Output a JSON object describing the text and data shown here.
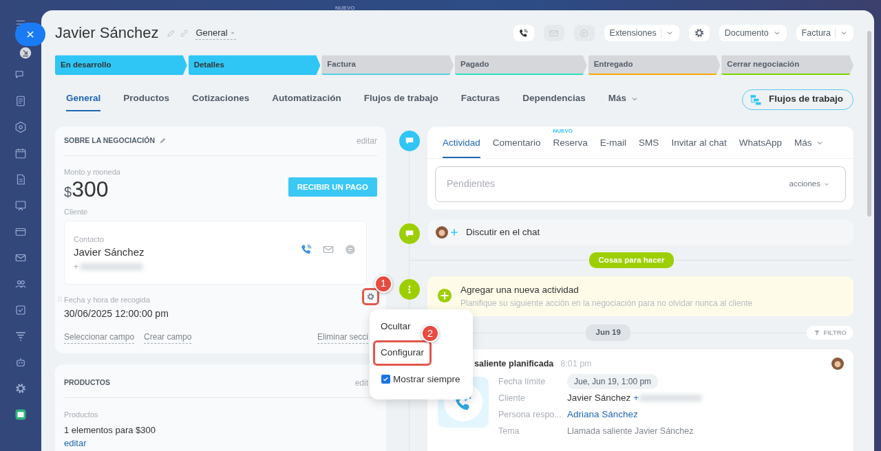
{
  "background": {
    "label": "NUEVO"
  },
  "header": {
    "title": "Javier Sánchez",
    "view": "General",
    "toolbar": [
      {
        "kind": "phone",
        "disabled": false
      },
      {
        "kind": "mail",
        "disabled": true
      },
      {
        "kind": "chat",
        "disabled": true
      },
      {
        "kind": "split",
        "label": "Extensiones",
        "disabled": false
      },
      {
        "kind": "settings",
        "disabled": false
      },
      {
        "kind": "dropdown",
        "label": "Documento",
        "disabled": false
      },
      {
        "kind": "split",
        "label": "Factura",
        "disabled": false
      }
    ]
  },
  "stages": [
    {
      "label": "En desarrollo",
      "color": "#2fc6f6",
      "reached": true
    },
    {
      "label": "Detalles",
      "color": "#2fc6f6",
      "reached": true
    },
    {
      "label": "Factura",
      "color": "#55d0e0",
      "reached": false
    },
    {
      "label": "Pagado",
      "color": "#2fe0c0",
      "reached": false
    },
    {
      "label": "Entregado",
      "color": "#ffa900",
      "reached": false
    },
    {
      "label": "Cerrar negociación",
      "color": "#7bd500",
      "reached": false
    }
  ],
  "tabs": [
    {
      "label": "General",
      "selected": true
    },
    {
      "label": "Productos",
      "selected": false
    },
    {
      "label": "Cotizaciones",
      "selected": false
    },
    {
      "label": "Automatización",
      "selected": false
    },
    {
      "label": "Flujos de trabajo",
      "selected": false
    },
    {
      "label": "Facturas",
      "selected": false
    },
    {
      "label": "Dependencias",
      "selected": false
    }
  ],
  "tabs_more": "Más",
  "workflow_button": "Flujos de trabajo",
  "about": {
    "title": "SOBRE LA NEGOCIACIÓN",
    "edit": "editar",
    "amount_label": "Monto y moneda",
    "currency": "$",
    "amount": "300",
    "pay_button": "RECIBIR UN PAGO",
    "client_label": "Cliente",
    "contact": {
      "label": "Contacto",
      "name": "Javier Sánchez",
      "phone_prefix": "+"
    },
    "field": {
      "label": "Fecha y hora de recogida",
      "value": "30/06/2025 12:00:00 pm",
      "highlighted": true,
      "callout": "1"
    },
    "links": [
      "Seleccionar campo",
      "Crear campo",
      "Eliminar secci"
    ]
  },
  "products": {
    "title": "PRODUCTOS",
    "edit": "edit",
    "label": "Productos",
    "value": "1 elementos para $300",
    "link": "editar"
  },
  "menu": {
    "items": [
      {
        "kind": "action",
        "label": "Ocultar",
        "highlighted": false
      },
      {
        "kind": "action",
        "label": "Configurar",
        "highlighted": true,
        "callout": "2"
      },
      {
        "kind": "checkbox",
        "label": "Mostrar siempre",
        "checked": true,
        "highlighted": false
      }
    ]
  },
  "timeline": {
    "composer": {
      "tabs": [
        {
          "label": "Actividad",
          "selected": true
        },
        {
          "label": "Comentario",
          "selected": false
        },
        {
          "label": "Reserva",
          "selected": false,
          "badge": "NUEVO"
        },
        {
          "label": "E-mail",
          "selected": false
        },
        {
          "label": "SMS",
          "selected": false
        },
        {
          "label": "Invitar al chat",
          "selected": false
        },
        {
          "label": "WhatsApp",
          "selected": false
        }
      ],
      "more": "Más",
      "placeholder": "Pendientes",
      "actions": "acciones"
    },
    "chat": {
      "label": "Discutir en el chat"
    },
    "section_label": "Cosas para hacer",
    "todo": {
      "title": "Agregar una nueva actividad",
      "subtitle": "Planifique su siguiente acción en la negociación para no olvidar nunca al cliente"
    },
    "date": "Jun 19",
    "filter": "FILTRO",
    "activity": {
      "title": "saliente planificada",
      "time": "8:01 pm",
      "fields": [
        {
          "kind": "pill",
          "label": "Fecha límite",
          "value": "Jue, Jun 19, 1:00 pm"
        },
        {
          "kind": "contact",
          "label": "Cliente",
          "value": "Javier Sánchez",
          "suffix": "+"
        },
        {
          "kind": "link",
          "label": "Persona respo...",
          "value": "Adriana Sánchez"
        },
        {
          "kind": "text",
          "label": "Tema",
          "value": "Llamada saliente Javier Sánchez"
        }
      ]
    }
  }
}
